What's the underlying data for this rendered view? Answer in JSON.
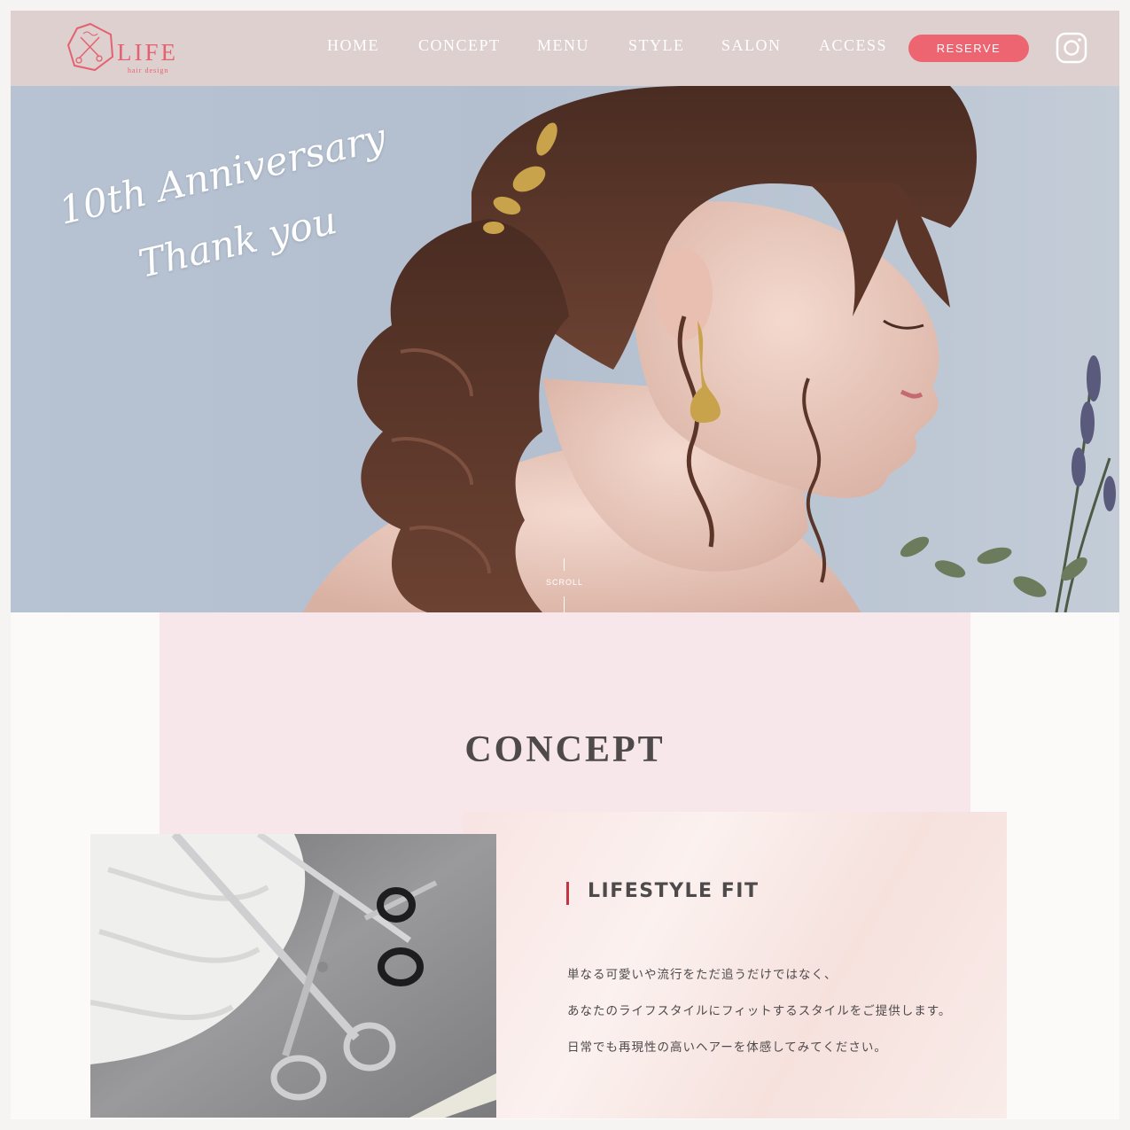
{
  "header": {
    "logo": {
      "name": "LIFE",
      "sub": "hair design"
    },
    "nav": [
      {
        "label": "HOME"
      },
      {
        "label": "CONCEPT"
      },
      {
        "label": "MENU"
      },
      {
        "label": "STYLE"
      },
      {
        "label": "SALON"
      },
      {
        "label": "ACCESS"
      }
    ],
    "reserve_label": "RESERVE",
    "social_icon": "instagram-icon"
  },
  "hero": {
    "line1": "10th Anniversary",
    "line2": "Thank you",
    "scroll_label": "SCROLL"
  },
  "concept": {
    "title": "CONCEPT",
    "heading": "LIFESTYLE FIT",
    "paragraphs": [
      "単なる可愛いや流行をただ追うだけではなく、",
      "あなたのライフスタイルにフィットするスタイルをご提供します。",
      "日常でも再現性の高いヘアーを体感してみてください。"
    ]
  },
  "colors": {
    "accent": "#ee6572",
    "header_bg": "#ddd0cf",
    "concept_bg": "#f7e7ea",
    "heading_bar": "#c5343e",
    "text": "#4e4a4b"
  }
}
